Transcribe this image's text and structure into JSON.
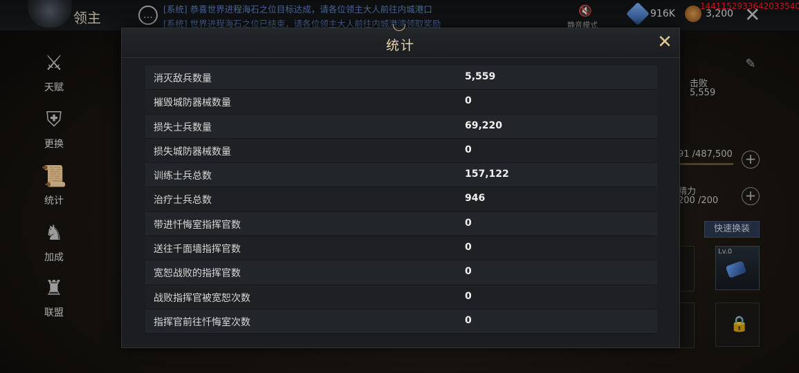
{
  "topbar": {
    "lord_title": "领主",
    "chat_icon": "chat-bubble-icon",
    "system_messages": [
      "[系统] 恭喜世界进程海石之位目标达成，请各位领主大人前往内城港口",
      "[系统] 世界进程海石之位已结束，请各位领主大人前往内城港湾领取奖励"
    ],
    "mute_label": "静音模式",
    "gem_value": "916K",
    "coin_value": "3,200",
    "id_text": "1441152933642033540"
  },
  "sidebar": {
    "items": [
      {
        "label": "天赋",
        "icon": "helmet-swords-icon"
      },
      {
        "label": "更换",
        "icon": "shield-swap-icon"
      },
      {
        "label": "统计",
        "icon": "scroll-icon"
      },
      {
        "label": "加成",
        "icon": "dragon-banner-icon"
      },
      {
        "label": "联盟",
        "icon": "alliance-crest-icon"
      }
    ]
  },
  "right_panel": {
    "defeat_label": "击败",
    "defeat_value": "5,559",
    "exp_text": "91 /487,500",
    "exp_fraction": 0.0002,
    "stamina_label": "精力",
    "stamina_value": "200 /200",
    "quick_equip_label": "快速换装",
    "slot_level": "Lv.0"
  },
  "modal": {
    "title": "统计",
    "close_icon": "close-x-icon",
    "stats": [
      {
        "label": "消灭敌兵数量",
        "value": "5,559"
      },
      {
        "label": "摧毁城防器械数量",
        "value": "0"
      },
      {
        "label": "损失士兵数量",
        "value": "69,220"
      },
      {
        "label": "损失城防器械数量",
        "value": "0"
      },
      {
        "label": "训练士兵总数",
        "value": "157,122"
      },
      {
        "label": "治疗士兵总数",
        "value": "946"
      },
      {
        "label": "带进忏悔室指挥官数",
        "value": "0"
      },
      {
        "label": "送往千面墙指挥官数",
        "value": "0"
      },
      {
        "label": "宽恕战败的指挥官数",
        "value": "0"
      },
      {
        "label": "战败指挥官被宽恕次数",
        "value": "0"
      },
      {
        "label": "指挥官前往忏悔室次数",
        "value": "0"
      }
    ]
  }
}
